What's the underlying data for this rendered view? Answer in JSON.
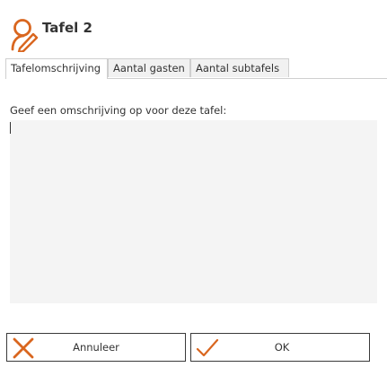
{
  "header": {
    "title": "Tafel 2",
    "icon": "user-edit-icon"
  },
  "tabs": [
    {
      "label": "Tafelomschrijving",
      "active": true
    },
    {
      "label": "Aantal gasten",
      "active": false
    },
    {
      "label": "Aantal subtafels",
      "active": false
    }
  ],
  "description": {
    "prompt": "Geef een omschrijving op voor deze tafel:",
    "value": ""
  },
  "buttons": {
    "cancel_label": "Annuleer",
    "cancel_icon": "close-icon",
    "ok_label": "OK",
    "ok_icon": "check-icon"
  },
  "colors": {
    "accent": "#d9661f",
    "text": "#333333"
  }
}
